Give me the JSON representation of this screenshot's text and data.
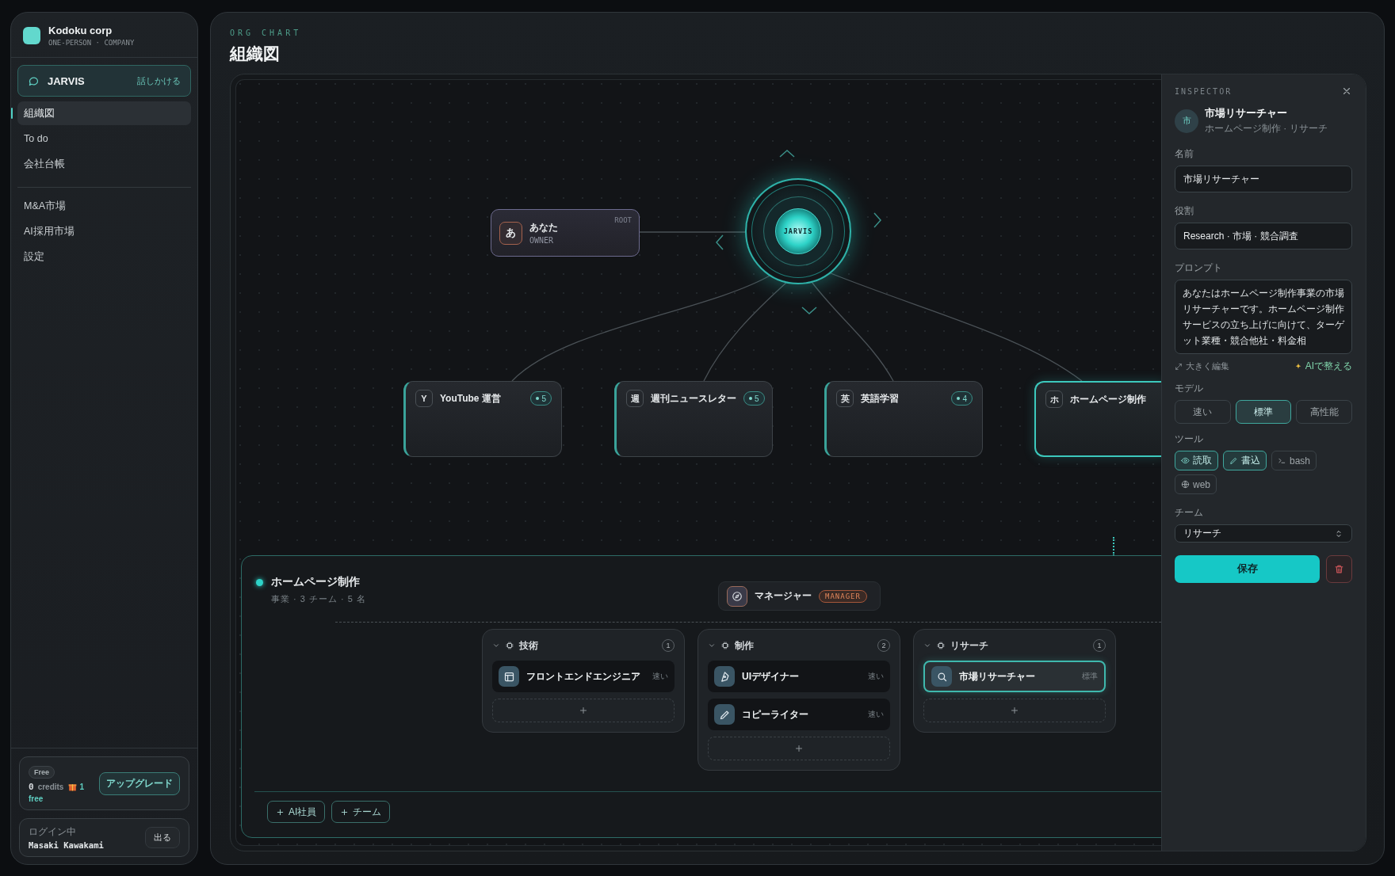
{
  "sidebar": {
    "brand": {
      "name": "Kodoku corp",
      "tagline": "ONE-PERSON · COMPANY"
    },
    "assistant": {
      "name": "JARVIS",
      "action": "話しかける"
    },
    "nav": [
      {
        "label": "組織図",
        "selected": true
      },
      {
        "label": "To do",
        "selected": false
      },
      {
        "label": "会社台帳",
        "selected": false
      }
    ],
    "nav_secondary": [
      {
        "label": "M&A市場",
        "selected": false
      },
      {
        "label": "AI採用市場",
        "selected": false
      },
      {
        "label": "設定",
        "selected": false
      }
    ],
    "plan": {
      "badge": "Free",
      "credits": "0",
      "credits_label": "credits",
      "gift_count": "1",
      "plan_name": "free",
      "upgrade": "アップグレード"
    },
    "account": {
      "status": "ログイン中",
      "user": "Masaki Kawakami",
      "logout": "出る"
    }
  },
  "header": {
    "eyebrow": "ORG CHART",
    "title": "組織図"
  },
  "org_chart": {
    "owner": {
      "initial": "あ",
      "name": "あなた",
      "role": "OWNER",
      "tag": "ROOT"
    },
    "hub": {
      "label": "JARVIS"
    },
    "businesses": [
      {
        "initial": "Y",
        "name": "YouTube 運営",
        "count": "5",
        "selected": false
      },
      {
        "initial": "週",
        "name": "週刊ニュースレター",
        "count": "5",
        "selected": false
      },
      {
        "initial": "英",
        "name": "英語学習",
        "count": "4",
        "selected": false
      },
      {
        "initial": "ホ",
        "name": "ホームページ制作",
        "selected": true
      }
    ]
  },
  "business_detail": {
    "title": "ホームページ制作",
    "meta": "事業 · 3 チーム · 5 名",
    "manager": {
      "name": "マネージャー",
      "badge": "MANAGER"
    },
    "teams": [
      {
        "name": "技術",
        "count": "1",
        "expanded": true,
        "members": [
          {
            "name": "フロントエンドエンジニア",
            "model": "速い",
            "kind": "layout",
            "selected": false
          }
        ]
      },
      {
        "name": "制作",
        "count": "2",
        "expanded": true,
        "members": [
          {
            "name": "UIデザイナー",
            "model": "速い",
            "kind": "pen",
            "selected": false
          },
          {
            "name": "コピーライター",
            "model": "速い",
            "kind": "pencil",
            "selected": false
          }
        ]
      },
      {
        "name": "リサーチ",
        "count": "1",
        "expanded": true,
        "members": [
          {
            "name": "市場リサーチャー",
            "model": "標準",
            "kind": "search",
            "selected": true
          }
        ]
      }
    ],
    "actions": [
      "AI社員",
      "チーム"
    ]
  },
  "inspector": {
    "eyebrow": "INSPECTOR",
    "avatar": "市",
    "name": "市場リサーチャー",
    "path": "ホームページ制作 · リサーチ",
    "name_field": {
      "label": "名前",
      "value": "市場リサーチャー"
    },
    "role_field": {
      "label": "役割",
      "value": "Research · 市場 · 競合調査"
    },
    "prompt_field": {
      "label": "プロンプト",
      "value": "あなたはホームページ制作事業の市場リサーチャーです。ホームページ制作サービスの立ち上げに向けて、ターゲット業種・競合他社・料金相"
    },
    "expand": "大きく編集",
    "ai_action": "AIで整える",
    "model": {
      "label": "モデル",
      "options": [
        {
          "label": "速い",
          "selected": false
        },
        {
          "label": "標準",
          "selected": true
        },
        {
          "label": "高性能",
          "selected": false
        }
      ]
    },
    "tools": {
      "label": "ツール",
      "items": [
        {
          "kind": "eye",
          "label": "読取",
          "on": true
        },
        {
          "kind": "pencil",
          "label": "書込",
          "on": true
        },
        {
          "kind": "terminal",
          "label": "bash",
          "on": false
        },
        {
          "kind": "globe",
          "label": "web",
          "on": false
        }
      ]
    },
    "team": {
      "label": "チーム",
      "value": "リサーチ"
    },
    "save": "保存"
  }
}
